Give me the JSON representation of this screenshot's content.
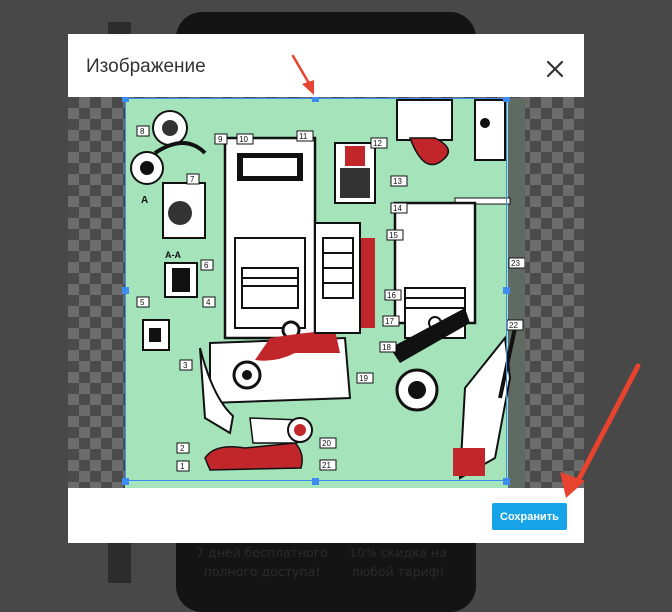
{
  "background": {
    "promo_left": [
      "7 дней бесплатного",
      "полного доступа!"
    ],
    "promo_right": [
      "10% скидка на",
      "любой тариф!"
    ]
  },
  "modal": {
    "title": "Изображение",
    "close_icon": "close-icon",
    "save_label": "Сохранить"
  },
  "diagram": {
    "labels": [
      "1",
      "2",
      "3",
      "4",
      "5",
      "6",
      "7",
      "8",
      "9",
      "10",
      "11",
      "12",
      "13",
      "14",
      "15",
      "16",
      "17",
      "18",
      "19",
      "20",
      "21",
      "22",
      "23"
    ],
    "section_labels": [
      "A",
      "A-A"
    ]
  },
  "colors": {
    "accent": "#17a3e8",
    "crop_border": "#3d8cf0",
    "annotation_arrow": "#e8432e",
    "image_background": "#a5e3bb",
    "part_highlight": "#c0262a"
  }
}
